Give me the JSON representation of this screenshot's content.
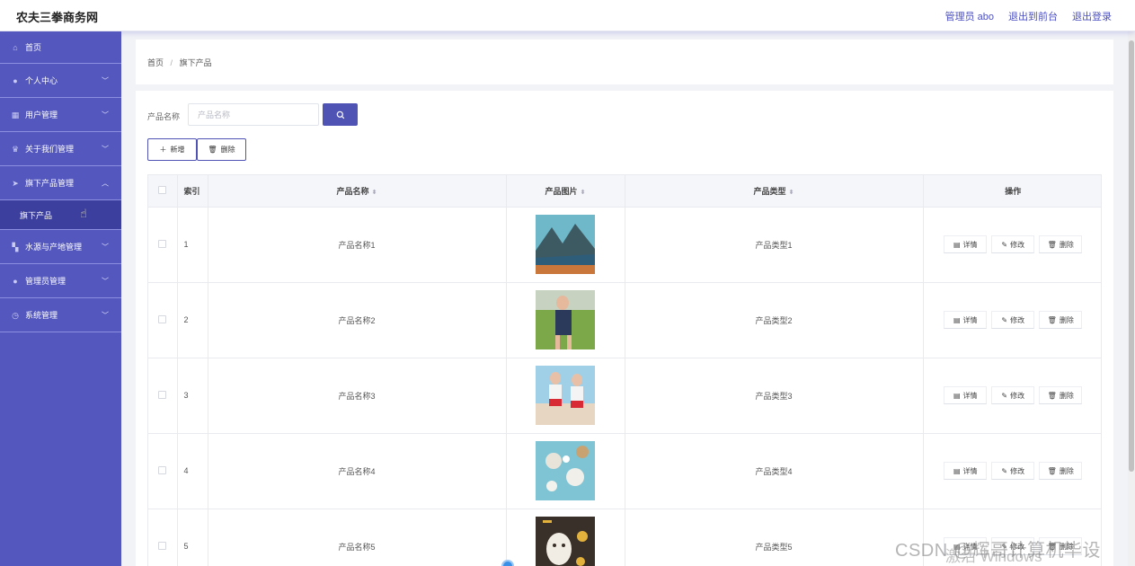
{
  "header": {
    "brand": "农夫三拳商务网",
    "links": [
      "管理员 abo",
      "退出到前台",
      "退出登录"
    ]
  },
  "sidebar": {
    "items": [
      {
        "label": "首页",
        "icon": "home-icon",
        "has_chevron": false
      },
      {
        "label": "个人中心",
        "icon": "user-icon",
        "has_chevron": true
      },
      {
        "label": "用户管理",
        "icon": "calendar-icon",
        "has_chevron": true
      },
      {
        "label": "关于我们管理",
        "icon": "trophy-icon",
        "has_chevron": true
      },
      {
        "label": "旗下产品管理",
        "icon": "send-icon",
        "has_chevron": true,
        "expanded": true
      }
    ],
    "subitem": "旗下产品",
    "items_after": [
      {
        "label": "水源与产地管理",
        "icon": "grid-icon",
        "has_chevron": true
      },
      {
        "label": "管理员管理",
        "icon": "user-icon",
        "has_chevron": true
      },
      {
        "label": "系统管理",
        "icon": "clock-icon",
        "has_chevron": true
      }
    ]
  },
  "breadcrumb": {
    "home": "首页",
    "sep": "/",
    "current": "旗下产品"
  },
  "search": {
    "label": "产品名称",
    "placeholder": "产品名称"
  },
  "actions": {
    "add": "新增",
    "delete": "删除"
  },
  "table": {
    "headers": {
      "index": "索引",
      "name": "产品名称",
      "image": "产品图片",
      "type": "产品类型",
      "ops": "操作"
    },
    "op_labels": {
      "detail": "详情",
      "edit": "修改",
      "delete": "删除"
    },
    "rows": [
      {
        "index": "1",
        "name": "产品名称1",
        "type": "产品类型1",
        "image": "mountain-lake-photo"
      },
      {
        "index": "2",
        "name": "产品名称2",
        "type": "产品类型2",
        "image": "swimsuit-photo"
      },
      {
        "index": "3",
        "name": "产品名称3",
        "type": "产品类型3",
        "image": "two-women-photo"
      },
      {
        "index": "4",
        "name": "产品名称4",
        "type": "产品类型4",
        "image": "spa-stones-photo"
      },
      {
        "index": "5",
        "name": "产品名称5",
        "type": "产品类型5",
        "image": "face-mask-photo"
      }
    ]
  },
  "watermark": {
    "csdn": "CSDN @辉哥计算机毕设",
    "windows": "激活 Windows"
  },
  "colors": {
    "sidebar": "#5457be",
    "sidebar_active": "#3d3f9e",
    "accent": "#4f53b4"
  }
}
